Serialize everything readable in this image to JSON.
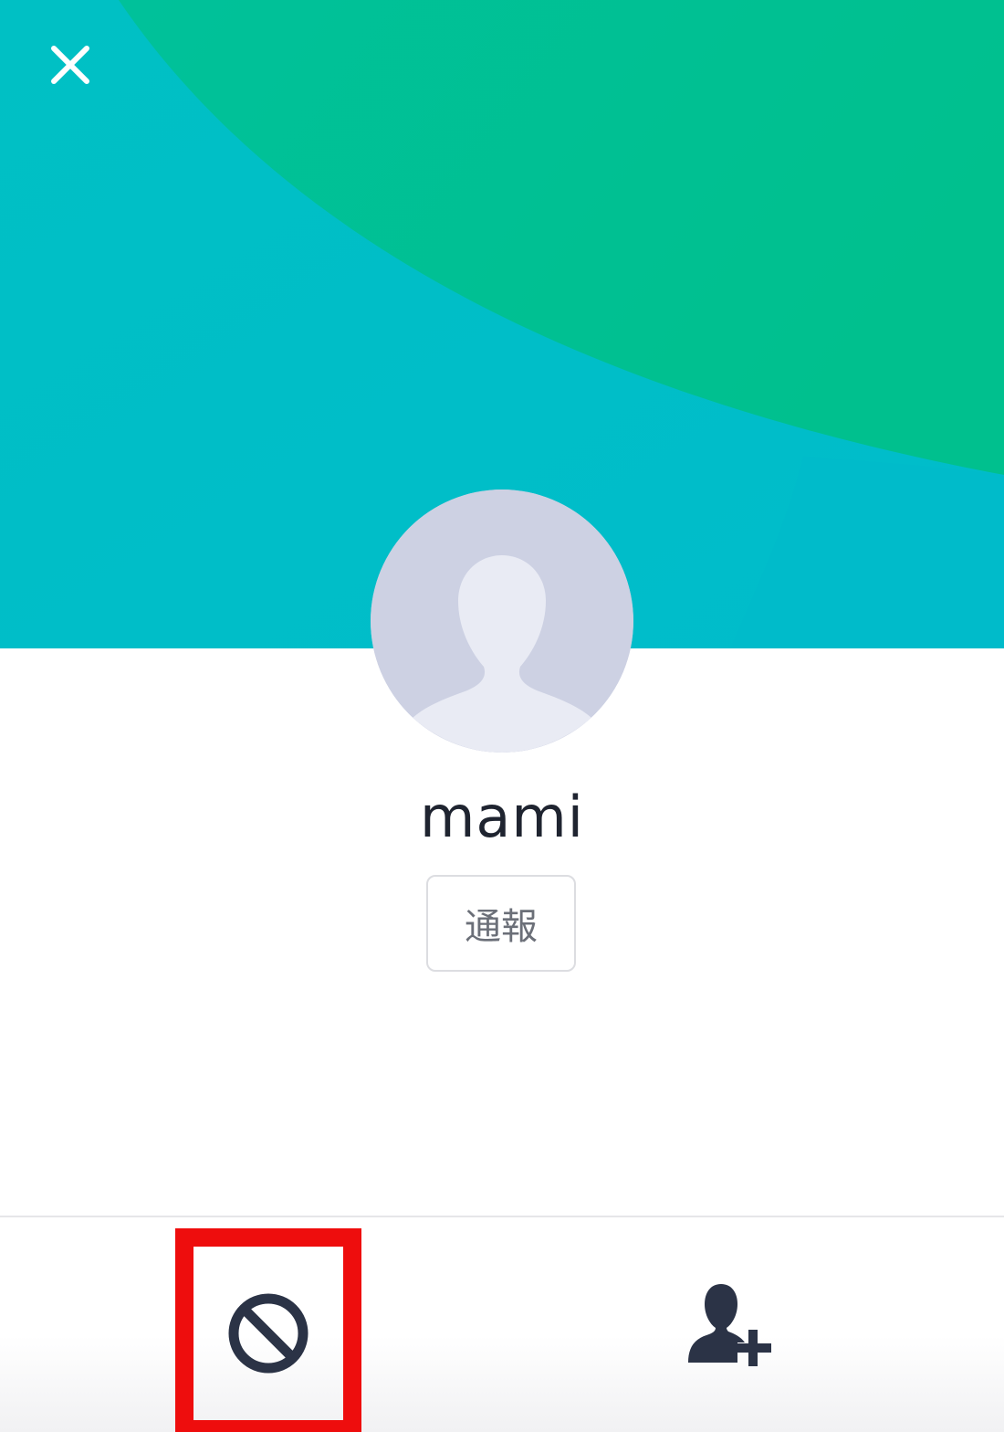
{
  "profile": {
    "name": "mami",
    "report_label": "通報"
  },
  "icons": {
    "close": "close-icon",
    "avatar": "default-person-avatar",
    "block": "block-icon",
    "add_friend": "add-friend-icon"
  },
  "colors": {
    "header_green": "#00c08e",
    "header_teal": "#00bfc6",
    "highlight_red": "#ee0d0d",
    "icon_navy": "#2b3346",
    "avatar_bg": "#cdd1e3",
    "avatar_figure": "#e9ebf4"
  }
}
